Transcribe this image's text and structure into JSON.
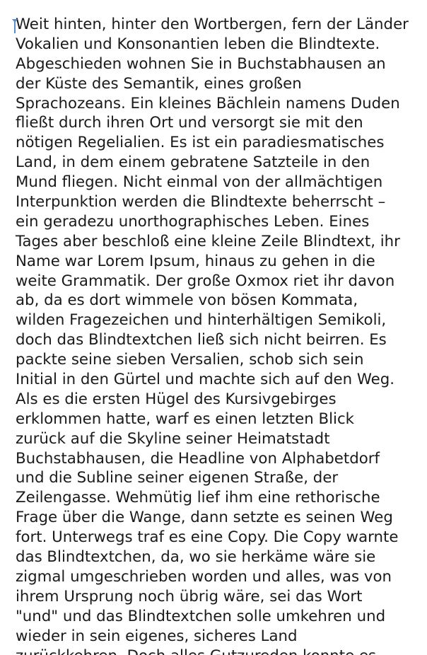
{
  "editor": {
    "accent_color": "#5b8dd6",
    "text_color": "#1a1a1a",
    "background_color": "#ffffff",
    "lines": [
      "Weit hinten, hinter den Wortbergen, fern der Länder",
      "Vokalien und Konsonantien leben die Blindtexte.",
      "Abgeschieden wohnen Sie in Buchstabhausen an",
      "der Küste des Semantik, eines großen",
      "Sprachozeans. Ein kleines Bächlein namens Duden",
      "fließt durch ihren Ort und versorgt sie mit den",
      "nötigen Regelialien. Es ist ein paradiesmatisches",
      "Land, in dem einem gebratene Satzteile in den",
      "Mund fliegen. Nicht einmal von der allmächtigen",
      "Interpunktion werden die Blindtexte beherrscht –",
      "ein geradezu unorthographisches Leben. Eines",
      "Tages aber beschloß eine kleine Zeile Blindtext, ihr",
      "Name war Lorem Ipsum, hinaus zu gehen in die",
      "weite Grammatik. Der große Oxmox riet ihr davon",
      "ab, da es dort wimmele von bösen Kommata,",
      "wilden Fragezeichen und hinterhältigen Semikoli,",
      "doch das Blindtextchen ließ sich nicht beirren. Es",
      "packte seine sieben Versalien, schob sich sein",
      "Initial in den Gürtel und machte sich auf den Weg.",
      "Als es die ersten Hügel des Kursivgebirges",
      "erklommen hatte, warf es einen letzten Blick",
      "zurück auf die Skyline seiner Heimatstadt",
      "Buchstabhausen, die Headline von Alphabetdorf",
      "und die Subline seiner eigenen Straße, der",
      "Zeilengasse. Wehmütig lief ihm eine rethorische",
      "Frage über die Wange, dann setzte es seinen Weg",
      "fort. Unterwegs traf es eine Copy. Die Copy warnte",
      "das Blindtextchen, da, wo sie herkäme wäre sie",
      "zigmal umgeschrieben worden und alles, was von",
      "ihrem Ursprung noch übrig wäre, sei das Wort",
      "\"und\" und das Blindtextchen solle umkehren und",
      "wieder in sein eigenes, sicheres Land",
      "zurückkehren. Doch alles Gutzureden konnte es"
    ]
  }
}
